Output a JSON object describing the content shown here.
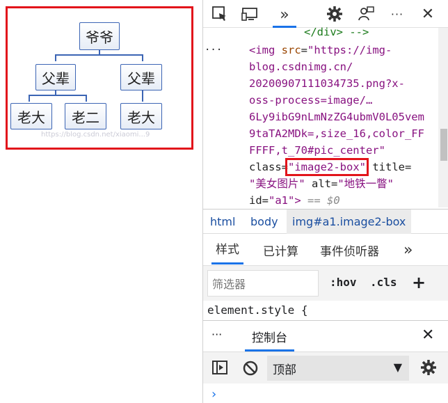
{
  "preview": {
    "watermark": "https://blog.csdn.net/xiaomi...9",
    "tree": {
      "root": "爷爷",
      "fathers": [
        "父辈",
        "父辈"
      ],
      "children": [
        "老大",
        "老二",
        "老大"
      ]
    }
  },
  "toolbar": {
    "icons": [
      "inspect-icon",
      "device-emulation-icon",
      "more-tabs-icon",
      "settings-icon",
      "feedback-icon",
      "more-options-icon",
      "close-icon"
    ],
    "more_tabs_glyph": "»",
    "ellipsis": "···",
    "close": "✕"
  },
  "elements": {
    "ellipsis": "···",
    "line0": "</div> -->",
    "line1_tag": "<img ",
    "line1_attr": "src",
    "line1_eq": "=",
    "line1_val": "\"https://img-",
    "line2": "blog.csdnimg.cn/",
    "line3": "20200907111034735.png?x-",
    "line4": "oss-process=image/…",
    "line5": "6Ly9ibG9nLmNzZG4ubmV0L05vem",
    "line6": "9taTA2MDk=,size_16,color_FF",
    "line7": "FFFF,t_70#pic_center\"",
    "line8_attr": "class",
    "line8_eq": "=",
    "line8_val": "\"image2-box\"",
    "line8_attr2": " title",
    "line8_eq2": "=",
    "line9_val": "\"美女图片\"",
    "line9_attr": " alt",
    "line9_eq": "=",
    "line9_val2": "\"地铁一瞥\"",
    "line10_attr": "id",
    "line10_eq": "=",
    "line10_val": "\"a1\"",
    "line10_end": ">",
    "line10_eqsign": " == $0"
  },
  "breadcrumbs": [
    "html",
    "body",
    "img#a1.image2-box"
  ],
  "styles_tabs": [
    "样式",
    "已计算",
    "事件侦听器",
    "»"
  ],
  "filter": {
    "placeholder": "筛选器",
    "hov": ":hov",
    "cls": ".cls",
    "plus": "+"
  },
  "element_style": "element.style {",
  "drawer": {
    "ellipsis": "···",
    "tab": "控制台",
    "close": "✕"
  },
  "console": {
    "context": "顶部",
    "dropdown": "▼",
    "prompt": "›"
  },
  "colors": {
    "highlight_red": "#e2141b",
    "link_blue": "#1a4ea0",
    "tag_purple": "#881280",
    "accent": "#1a73e8"
  }
}
